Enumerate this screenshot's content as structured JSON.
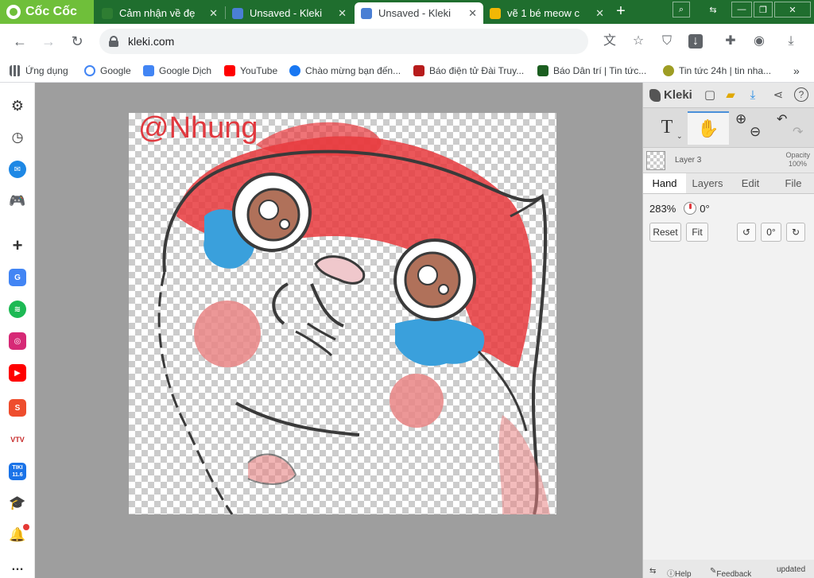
{
  "browser": {
    "brand": "Cốc Cốc",
    "tabs": [
      {
        "title": "Cảm nhận về đẹ",
        "active": false
      },
      {
        "title": "Unsaved - Kleki",
        "active": false
      },
      {
        "title": "Unsaved - Kleki",
        "active": true
      },
      {
        "title": "vẽ 1 bé meow c",
        "active": false
      }
    ],
    "new_tab": "+",
    "url": "kleki.com",
    "bookmarks": [
      {
        "label": "Ứng dụng"
      },
      {
        "label": "Google"
      },
      {
        "label": "Google Dịch"
      },
      {
        "label": "YouTube"
      },
      {
        "label": "Chào mừng bạn đến..."
      },
      {
        "label": "Báo điện tử Đài Truy..."
      },
      {
        "label": "Báo Dân trí | Tin tức..."
      },
      {
        "label": "Tin tức 24h | tin nha..."
      }
    ],
    "bookmarks_more": "»",
    "sidebar": {
      "vtv": "VTV",
      "tiki": "TIKI",
      "tiki_date": "11.6"
    }
  },
  "kleki": {
    "logo": "Kleki",
    "text_tool": "T",
    "layer_name": "Layer 3",
    "opacity_label": "Opacity",
    "opacity_value": "100%",
    "tabs": [
      "Hand",
      "Layers",
      "Edit",
      "File"
    ],
    "zoom": "283%",
    "angle": "0°",
    "reset": "Reset",
    "fit": "Fit",
    "rotate_value": "0°",
    "help": "Help",
    "feedback": "Feedback",
    "updated": "updated"
  },
  "artwork": {
    "watermark": "@Nhung",
    "colors": {
      "red": "#e8393d",
      "blue": "#3aa0dc",
      "pink": "#e98585",
      "line": "#3a3a3a"
    }
  }
}
